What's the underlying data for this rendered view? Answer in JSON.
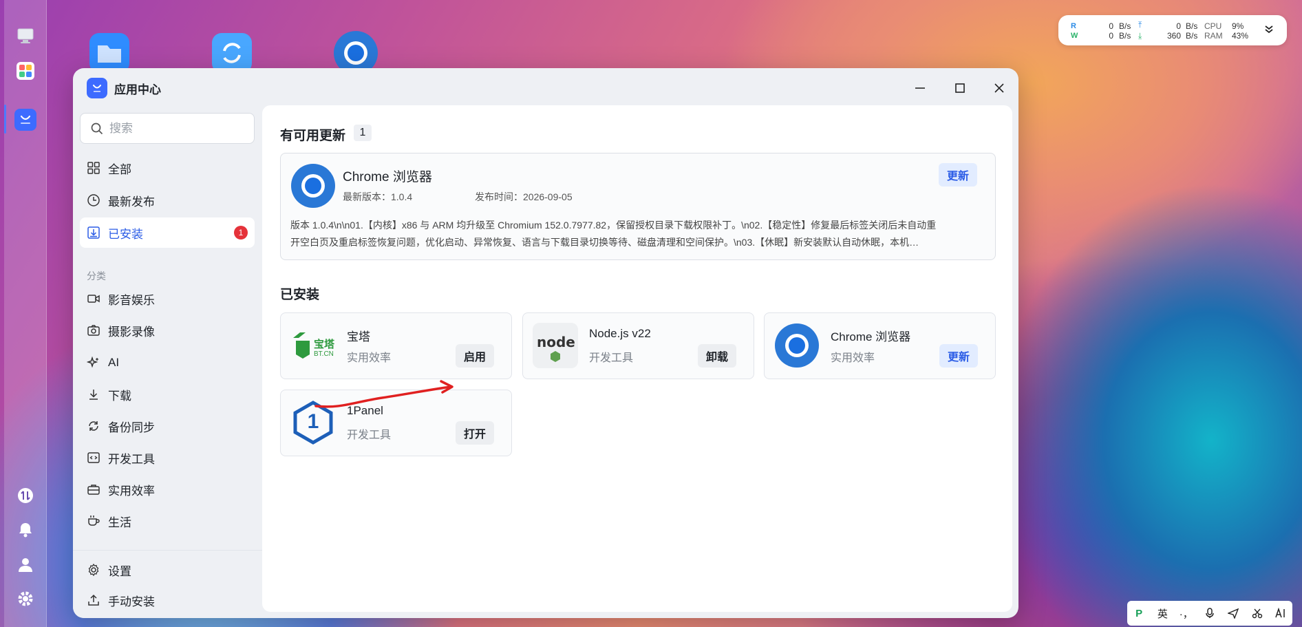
{
  "window": {
    "title": "应用中心"
  },
  "search": {
    "placeholder": "搜索"
  },
  "nav": {
    "all": "全部",
    "latest": "最新发布",
    "installed": "已安装",
    "installed_badge": "1",
    "category_label": "分类",
    "categories": [
      "影音娱乐",
      "摄影录像",
      "AI",
      "下载",
      "备份同步",
      "开发工具",
      "实用效率",
      "生活"
    ],
    "settings": "设置",
    "manual_install": "手动安装"
  },
  "updates": {
    "heading": "有可用更新",
    "count": "1",
    "app_name": "Chrome 浏览器",
    "version_label": "最新版本：1.0.4",
    "date_label": "发布时间：2026-09-05",
    "notes_line1": "版本 1.0.4\\n\\n01.【内核】x86 与 ARM 均升级至 Chromium 152.0.7977.82，保留授权目录下载权限补丁。\\n02.【稳定性】修复最后标签关闭后未自动重",
    "notes_line2": "开空白页及重启标签恢复问题，优化启动、异常恢复、语言与下载目录切换等待、磁盘清理和空间保护。\\n03.【休眠】新安装默认自动休眠，本机…",
    "update_button": "更新"
  },
  "installed": {
    "heading": "已安装",
    "apps": [
      {
        "name": "宝塔",
        "category": "实用效率",
        "action": "启用",
        "logo_text": "宝塔",
        "logo_sub": "BT.CN"
      },
      {
        "name": "Node.js v22",
        "category": "开发工具",
        "action": "卸载",
        "logo_text": "node"
      },
      {
        "name": "Chrome 浏览器",
        "category": "实用效率",
        "action": "更新"
      },
      {
        "name": "1Panel",
        "category": "开发工具",
        "action": "打开",
        "logo_text": "1"
      }
    ]
  },
  "monitor": {
    "r_label": "R",
    "w_label": "W",
    "r_speed": "0",
    "w_speed": "0",
    "unit": "B/s",
    "up_speed": "0",
    "down_speed": "360",
    "cpu_label": "CPU",
    "ram_label": "RAM",
    "cpu": "9%",
    "ram": "43%"
  },
  "ime": {
    "lang": "英",
    "punct": "·，"
  },
  "colors": {
    "accent": "#2b5ce6",
    "badge": "#e5323a",
    "annotation": "#e02020"
  }
}
